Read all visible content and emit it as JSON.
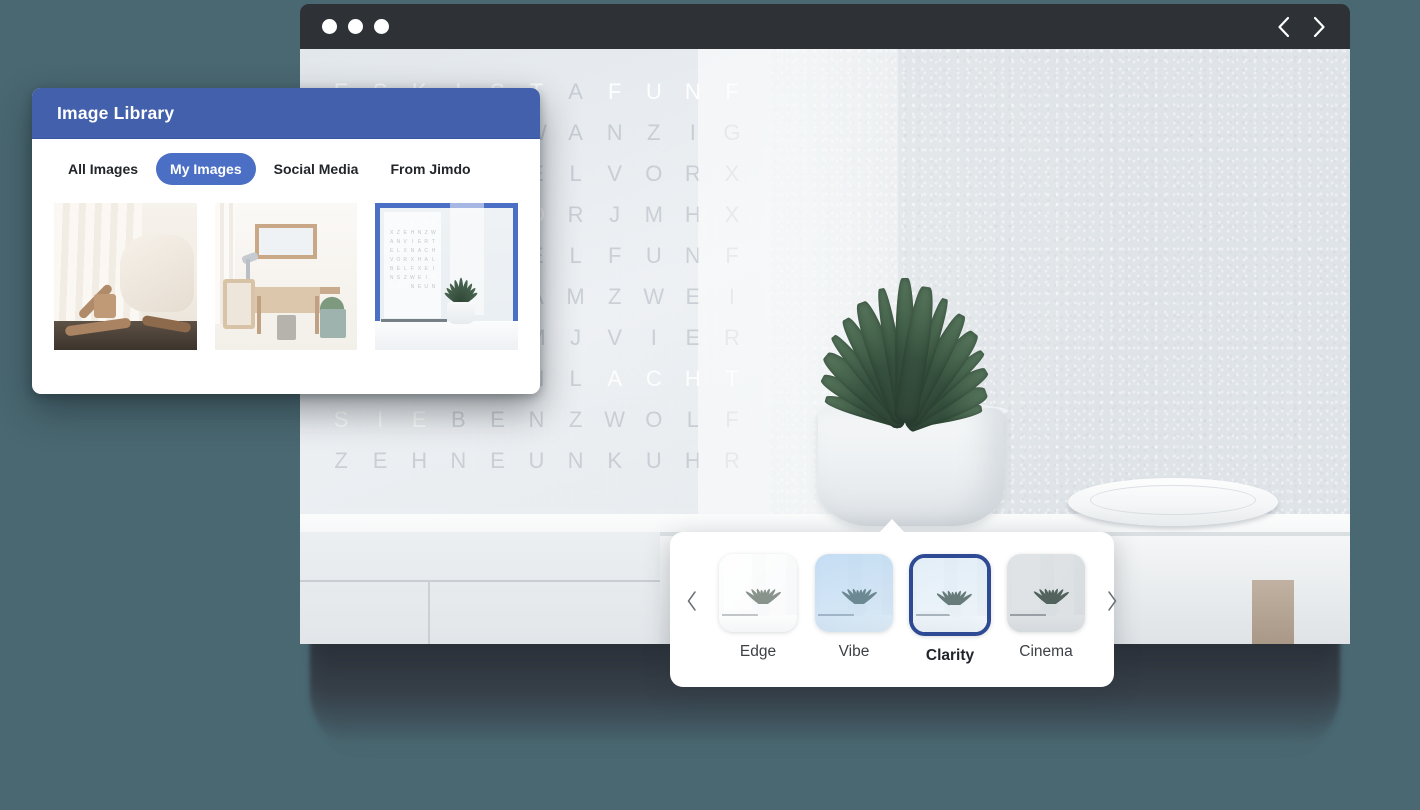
{
  "page": {
    "background_color": "#4a6872"
  },
  "browser": {
    "titlebar": {
      "traffic_lights": [
        "dot-1",
        "dot-2",
        "dot-3"
      ],
      "nav_back_icon": "chevron-left-icon",
      "nav_forward_icon": "chevron-right-icon",
      "background_color": "#2e3135"
    }
  },
  "canvas": {
    "photo_description": "Succulent plant in white ceramic pot on a white shelf",
    "poster_letters": [
      "E",
      "S",
      "K",
      "I",
      "S",
      "T",
      "A",
      "F",
      "U",
      "N",
      "F",
      "Z",
      "E",
      "H",
      "N",
      "Z",
      "W",
      "A",
      "N",
      "Z",
      "I",
      "G",
      "V",
      "I",
      "E",
      "R",
      "T",
      "E",
      "L",
      "V",
      "O",
      "R",
      "X",
      "N",
      "A",
      "C",
      "H",
      "V",
      "O",
      "R",
      "J",
      "M",
      "H",
      "X",
      "H",
      "A",
      "L",
      "B",
      "X",
      "E",
      "L",
      "F",
      "U",
      "N",
      "F",
      "E",
      "I",
      "N",
      "S",
      "X",
      "A",
      "M",
      "Z",
      "W",
      "E",
      "I",
      "D",
      "R",
      "E",
      "I",
      "P",
      "M",
      "J",
      "V",
      "I",
      "E",
      "R",
      "S",
      "E",
      "C",
      "H",
      "S",
      "N",
      "L",
      "A",
      "C",
      "H",
      "T",
      "S",
      "I",
      "E",
      "B",
      "E",
      "N",
      "Z",
      "W",
      "O",
      "L",
      "F",
      "Z",
      "E",
      "H",
      "N",
      "E",
      "U",
      "N",
      "K",
      "U",
      "H",
      "R"
    ],
    "poster_lit_indices": [
      0,
      1,
      2,
      3,
      4,
      5,
      7,
      8,
      9,
      10,
      35,
      36,
      37,
      38,
      84,
      85,
      86,
      87,
      88,
      89,
      90
    ]
  },
  "library": {
    "title": "Image Library",
    "header_color": "#4260ab",
    "accent_color": "#4a6fc4",
    "tabs": [
      {
        "label": "All Images",
        "active": false
      },
      {
        "label": "My Images",
        "active": true
      },
      {
        "label": "Social Media",
        "active": false
      },
      {
        "label": "From Jimdo",
        "active": false
      }
    ],
    "images": [
      {
        "name": "bedroom-sofa-thumbnail",
        "selected": false
      },
      {
        "name": "desk-workspace-thumbnail",
        "selected": false
      },
      {
        "name": "plant-shelf-thumbnail",
        "selected": true
      }
    ],
    "thumb3_poster_letters": [
      "E",
      "S",
      "T",
      "F",
      "U",
      "N",
      "F",
      "X",
      "Z",
      "E",
      "H",
      "N",
      "Z",
      "W",
      "A",
      "N",
      "V",
      "I",
      "E",
      "R",
      "T",
      "E",
      "L",
      "X",
      "N",
      "A",
      "C",
      "H",
      "V",
      "O",
      "R",
      "X",
      "H",
      "A",
      "L",
      "B",
      "E",
      "L",
      "F",
      "X",
      "E",
      "I",
      "N",
      "S",
      "Z",
      "W",
      "E",
      "I",
      "A",
      "C",
      "H",
      "T",
      "N",
      "E",
      "U",
      "N"
    ],
    "thumb3_lit_indices": [
      0,
      1,
      2,
      3,
      4,
      5,
      6,
      48,
      49,
      50,
      51
    ]
  },
  "filter_panel": {
    "prev_icon": "chevron-left-icon",
    "next_icon": "chevron-right-icon",
    "selected_border_color": "#2f4a94",
    "filters": [
      {
        "label": "Edge",
        "selected": false,
        "tint": "tint-edge"
      },
      {
        "label": "Vibe",
        "selected": false,
        "tint": "tint-vibe"
      },
      {
        "label": "Clarity",
        "selected": true,
        "tint": "tint-clarity"
      },
      {
        "label": "Cinema",
        "selected": false,
        "tint": "tint-cinema"
      }
    ]
  }
}
